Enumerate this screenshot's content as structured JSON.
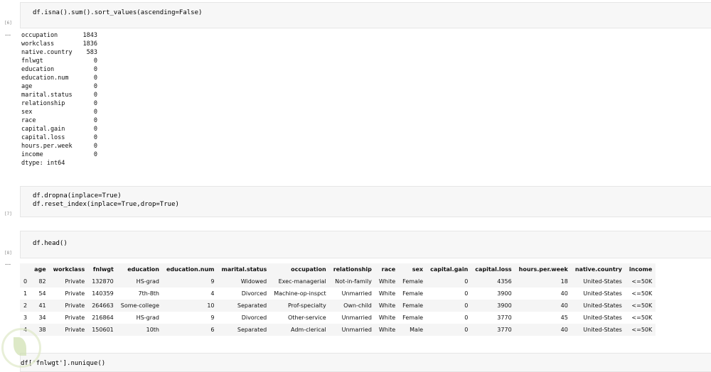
{
  "cells": [
    {
      "exec": "[6]",
      "code": "df.isna().sum().sort_values(ascending=False)"
    },
    {
      "exec": "[7]",
      "code_lines": [
        "df.dropna(inplace=True)",
        "df.reset_index(inplace=True,drop=True)"
      ]
    },
    {
      "exec": "[8]",
      "code": "df.head()"
    },
    {
      "code": "df['fnlwgt'].nunique()"
    }
  ],
  "output_marker": "...",
  "na_counts": [
    [
      "occupation",
      "1843"
    ],
    [
      "workclass",
      "1836"
    ],
    [
      "native.country",
      "583"
    ],
    [
      "fnlwgt",
      "0"
    ],
    [
      "education",
      "0"
    ],
    [
      "education.num",
      "0"
    ],
    [
      "age",
      "0"
    ],
    [
      "marital.status",
      "0"
    ],
    [
      "relationship",
      "0"
    ],
    [
      "sex",
      "0"
    ],
    [
      "race",
      "0"
    ],
    [
      "capital.gain",
      "0"
    ],
    [
      "capital.loss",
      "0"
    ],
    [
      "hours.per.week",
      "0"
    ],
    [
      "income",
      "0"
    ]
  ],
  "dtype": "dtype: int64",
  "table": {
    "columns": [
      "",
      "age",
      "workclass",
      "fnlwgt",
      "education",
      "education.num",
      "marital.status",
      "occupation",
      "relationship",
      "race",
      "sex",
      "capital.gain",
      "capital.loss",
      "hours.per.week",
      "native.country",
      "income"
    ],
    "rows": [
      [
        "0",
        "82",
        "Private",
        "132870",
        "HS-grad",
        "9",
        "Widowed",
        "Exec-managerial",
        "Not-in-family",
        "White",
        "Female",
        "0",
        "4356",
        "18",
        "United-States",
        "<=50K"
      ],
      [
        "1",
        "54",
        "Private",
        "140359",
        "7th-8th",
        "4",
        "Divorced",
        "Machine-op-inspct",
        "Unmarried",
        "White",
        "Female",
        "0",
        "3900",
        "40",
        "United-States",
        "<=50K"
      ],
      [
        "2",
        "41",
        "Private",
        "264663",
        "Some-college",
        "10",
        "Separated",
        "Prof-specialty",
        "Own-child",
        "White",
        "Female",
        "0",
        "3900",
        "40",
        "United-States",
        "<=50K"
      ],
      [
        "3",
        "34",
        "Private",
        "216864",
        "HS-grad",
        "9",
        "Divorced",
        "Other-service",
        "Unmarried",
        "White",
        "Female",
        "0",
        "3770",
        "45",
        "United-States",
        "<=50K"
      ],
      [
        "4",
        "38",
        "Private",
        "150601",
        "10th",
        "6",
        "Separated",
        "Adm-clerical",
        "Unmarried",
        "White",
        "Male",
        "0",
        "3770",
        "40",
        "United-States",
        "<=50K"
      ]
    ]
  }
}
